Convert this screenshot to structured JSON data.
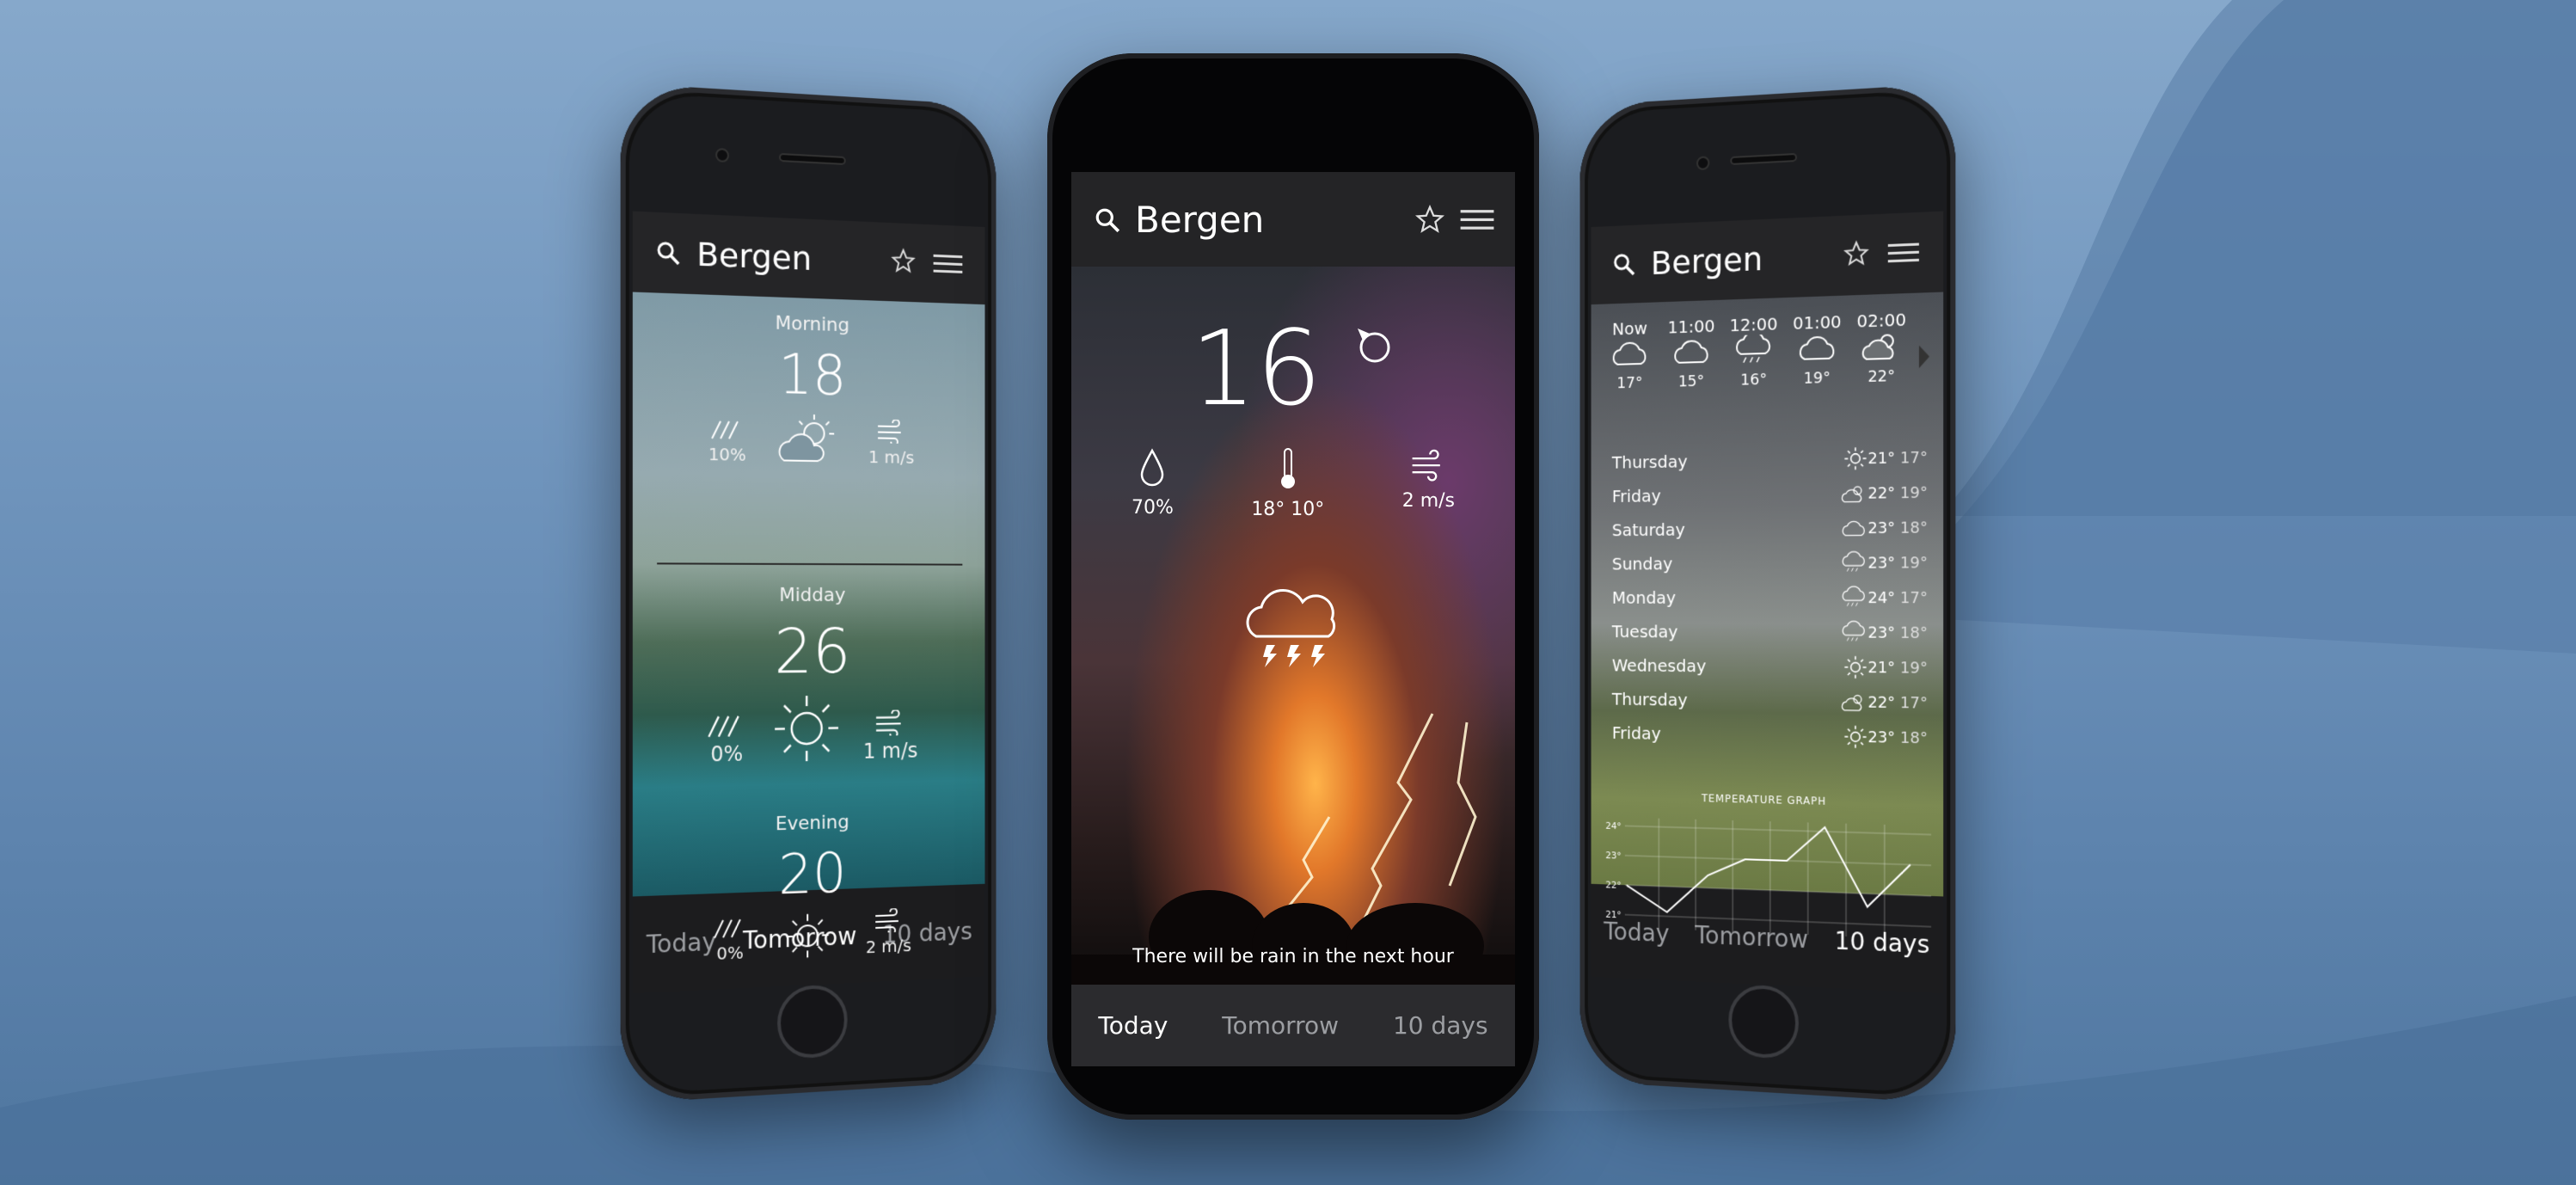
{
  "left_phone": {
    "search_icon": "search-icon",
    "city": "Bergen",
    "periods": [
      {
        "label": "Morning",
        "temp": "18",
        "rain": "10%",
        "wind": "1 m/s"
      },
      {
        "label": "Midday",
        "temp": "26",
        "rain": "0%",
        "wind": "1 m/s"
      },
      {
        "label": "Evening",
        "temp": "20",
        "rain": "0%",
        "wind": "2 m/s"
      }
    ],
    "tabs": [
      "Today",
      "Tomorrow",
      "10 days"
    ],
    "active_tab": "Tomorrow"
  },
  "center_phone": {
    "city": "Bergen",
    "temp": "16",
    "humidity": "70%",
    "temp_range": "18° 10°",
    "wind": "2 m/s",
    "message": "There will be rain in the next hour",
    "tabs": [
      "Today",
      "Tomorrow",
      "10 days"
    ],
    "active_tab": "Today"
  },
  "right_phone": {
    "city": "Bergen",
    "hours": [
      {
        "time": "Now",
        "temp": "17°"
      },
      {
        "time": "11:00",
        "temp": "15°"
      },
      {
        "time": "12:00",
        "temp": "16°"
      },
      {
        "time": "01:00",
        "temp": "19°"
      },
      {
        "time": "02:00",
        "temp": "22°"
      }
    ],
    "days": [
      {
        "name": "Thursday",
        "high": "21°",
        "low": "17°"
      },
      {
        "name": "Friday",
        "high": "22°",
        "low": "19°"
      },
      {
        "name": "Saturday",
        "high": "23°",
        "low": "18°"
      },
      {
        "name": "Sunday",
        "high": "23°",
        "low": "19°"
      },
      {
        "name": "Monday",
        "high": "24°",
        "low": "17°"
      },
      {
        "name": "Tuesday",
        "high": "23°",
        "low": "18°"
      },
      {
        "name": "Wednesday",
        "high": "21°",
        "low": "19°"
      },
      {
        "name": "Thursday",
        "high": "22°",
        "low": "17°"
      },
      {
        "name": "Friday",
        "high": "23°",
        "low": "18°"
      }
    ],
    "graph_title": "TEMPERATURE GRAPH",
    "graph_ticks": [
      "24°",
      "23°",
      "22°",
      "21°"
    ],
    "tabs": [
      "Today",
      "Tomorrow",
      "10 days"
    ],
    "active_tab": "10 days"
  }
}
